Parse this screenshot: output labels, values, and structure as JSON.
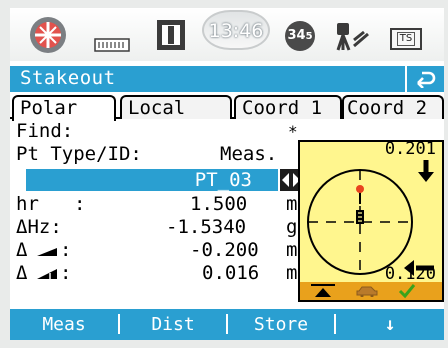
{
  "statusbar": {
    "time": "13:46",
    "satellites_count": "34",
    "satellites_sub": "5",
    "ts_label": "TS",
    "icons": [
      "target-prism-icon",
      "battery-bar-icon",
      "input-mode-I-icon",
      "satellite-count-icon",
      "tripod-instrument-icon",
      "ts-card-icon"
    ]
  },
  "title": "Stakeout",
  "tabs": [
    {
      "label": "Polar",
      "active": true
    },
    {
      "label": "Local"
    },
    {
      "label": "Coord 1"
    },
    {
      "label": "Coord 2"
    }
  ],
  "form": {
    "find_label": "Find:",
    "find_value": "*",
    "pt_type_label": "Pt Type/ID:",
    "pt_type_value": "Meas.",
    "point_id": "PT_03",
    "hr_label": "hr",
    "hr_colon": ":",
    "hr_value": "1.500",
    "hr_unit": "m",
    "dhz_label": "ΔHz:",
    "dhz_value": "-1.5340",
    "dhz_unit": "g",
    "dist1_label": "Δ",
    "dist1_value": "-0.200",
    "dist1_unit": "m",
    "dist2_label": "Δ",
    "dist2_value": "0.016",
    "dist2_unit": "m"
  },
  "graphic": {
    "top_value": "0.201",
    "bottom_value": "0.120"
  },
  "softkeys": [
    "Meas",
    "Dist",
    "Store",
    "↓"
  ],
  "colors": {
    "accent": "#2a9fd1",
    "panel_bg": "#fff68e",
    "panel_bar": "#e9a11c"
  }
}
